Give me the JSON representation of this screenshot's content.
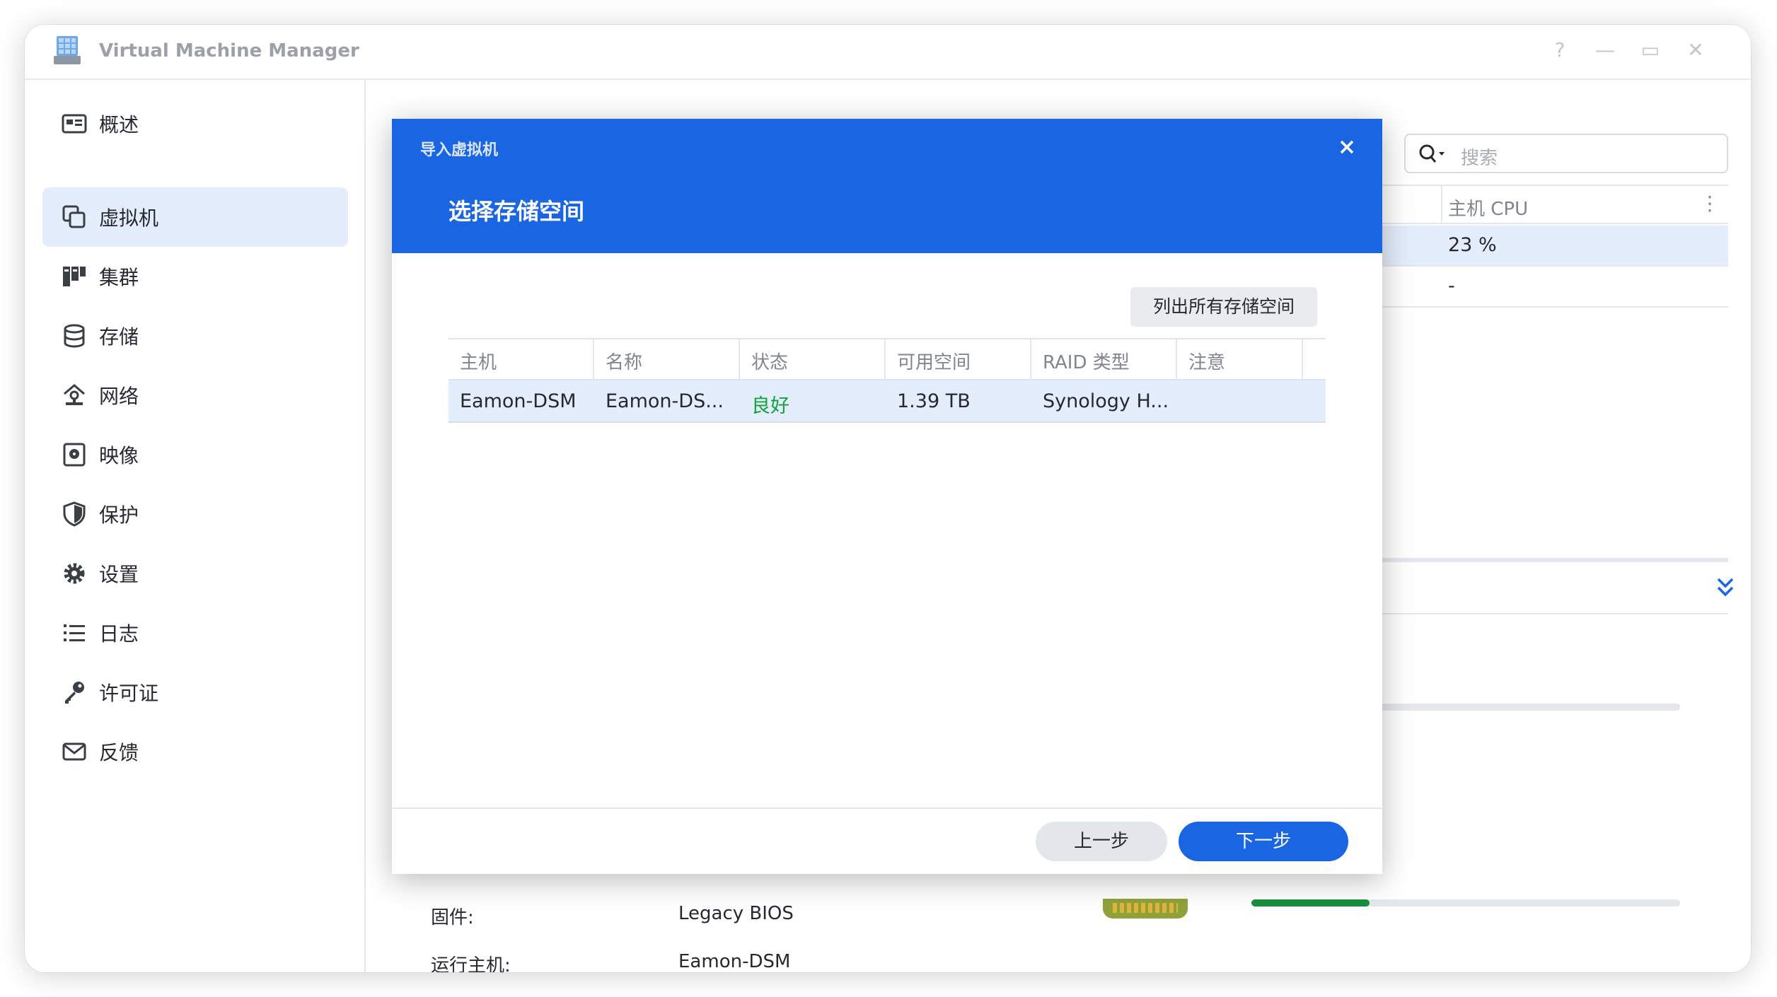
{
  "window": {
    "title": "Virtual Machine Manager",
    "controls": {
      "help": "?",
      "minimize": "—",
      "maximize": "▭",
      "close": "✕"
    }
  },
  "sidebar": {
    "items": [
      {
        "label": "概述",
        "icon": "overview-icon",
        "active": false
      },
      {
        "label": "虚拟机",
        "icon": "virtual-machine-icon",
        "active": true
      },
      {
        "label": "集群",
        "icon": "cluster-icon",
        "active": false
      },
      {
        "label": "存储",
        "icon": "storage-icon",
        "active": false
      },
      {
        "label": "网络",
        "icon": "network-icon",
        "active": false
      },
      {
        "label": "映像",
        "icon": "image-icon",
        "active": false
      },
      {
        "label": "保护",
        "icon": "shield-icon",
        "active": false
      },
      {
        "label": "设置",
        "icon": "gear-icon",
        "active": false
      },
      {
        "label": "日志",
        "icon": "log-list-icon",
        "active": false
      },
      {
        "label": "许可证",
        "icon": "key-icon",
        "active": false
      },
      {
        "label": "反馈",
        "icon": "mail-icon",
        "active": false
      }
    ]
  },
  "main": {
    "search": {
      "placeholder": "搜索"
    },
    "grid": {
      "column": "主机 CPU",
      "rows": [
        {
          "value": "23 %",
          "selected": true
        },
        {
          "value": "-",
          "selected": false
        }
      ]
    },
    "usage_bar": {
      "fill": 0.275
    },
    "details": [
      {
        "label": "固件:",
        "value": "Legacy BIOS"
      },
      {
        "label": "运行主机:",
        "value": "Eamon-DSM"
      }
    ]
  },
  "dialog": {
    "caption": "导入虚拟机",
    "title": "选择存储空间",
    "list_all_button": "列出所有存储空间",
    "columns": [
      "主机",
      "名称",
      "状态",
      "可用空间",
      "RAID 类型",
      "注意"
    ],
    "rows": [
      {
        "host": "Eamon-DSM",
        "name": "Eamon-DS...",
        "status": "良好",
        "free": "1.39 TB",
        "raid": "Synology H...",
        "note": ""
      }
    ],
    "prev_button": "上一步",
    "next_button": "下一步"
  },
  "colors": {
    "accent": "#1a66e2",
    "status_good": "#12a13a",
    "selection": "#e3edfb"
  }
}
